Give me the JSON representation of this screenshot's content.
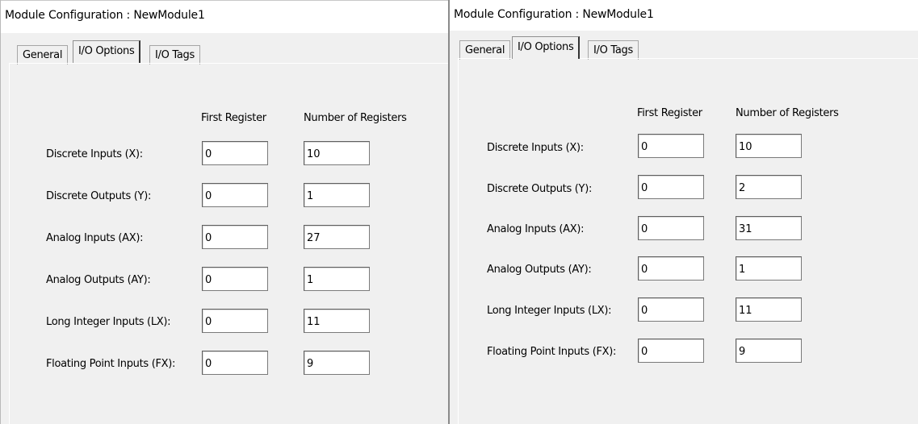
{
  "windows": [
    {
      "title": "Module Configuration : NewModule1",
      "tabs": [
        "General",
        "I/O Options",
        "I/O Tags"
      ],
      "active_tab": "I/O Options",
      "columns": {
        "first_register": "First Register",
        "number_of_registers": "Number of Registers"
      },
      "rows": [
        {
          "label": "Discrete Inputs (X):",
          "first": "0",
          "count": "10"
        },
        {
          "label": "Discrete Outputs (Y):",
          "first": "0",
          "count": "1"
        },
        {
          "label": "Analog Inputs (AX):",
          "first": "0",
          "count": "27"
        },
        {
          "label": "Analog Outputs (AY):",
          "first": "0",
          "count": "1"
        },
        {
          "label": "Long Integer Inputs (LX):",
          "first": "0",
          "count": "11"
        },
        {
          "label": "Floating Point Inputs (FX):",
          "first": "0",
          "count": "9"
        }
      ]
    },
    {
      "title": "Module Configuration : NewModule1",
      "tabs": [
        "General",
        "I/O Options",
        "I/O Tags"
      ],
      "active_tab": "I/O Options",
      "columns": {
        "first_register": "First Register",
        "number_of_registers": "Number of Registers"
      },
      "rows": [
        {
          "label": "Discrete Inputs (X):",
          "first": "0",
          "count": "10"
        },
        {
          "label": "Discrete Outputs (Y):",
          "first": "0",
          "count": "2"
        },
        {
          "label": "Analog Inputs (AX):",
          "first": "0",
          "count": "31"
        },
        {
          "label": "Analog Outputs (AY):",
          "first": "0",
          "count": "1"
        },
        {
          "label": "Long Integer Inputs (LX):",
          "first": "0",
          "count": "11"
        },
        {
          "label": "Floating Point Inputs (FX):",
          "first": "0",
          "count": "9"
        }
      ]
    }
  ]
}
